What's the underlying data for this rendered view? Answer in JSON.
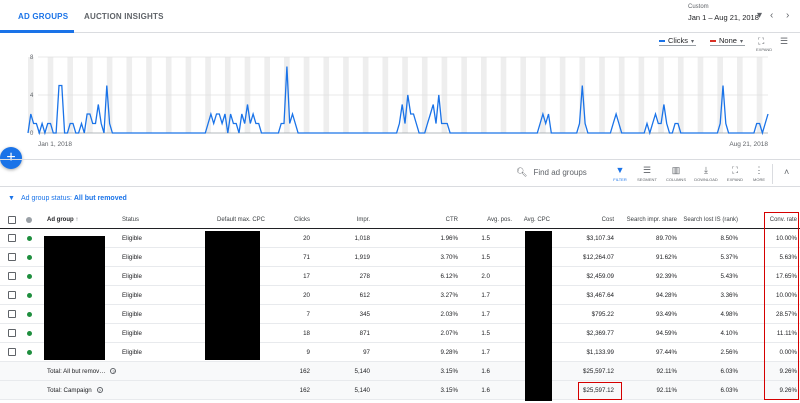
{
  "tabs": [
    {
      "label": "AD GROUPS"
    },
    {
      "label": "AUCTION INSIGHTS"
    }
  ],
  "date": {
    "label": "Custom",
    "range": "Jan 1 – Aug 21, 2018"
  },
  "chart": {
    "metric1": "Clicks",
    "metric2": "None",
    "expand_label": "EXPAND",
    "colors": {
      "metric1": "#1a73e8",
      "metric2": "#d93025"
    }
  },
  "chart_data": {
    "type": "line",
    "xlabel": "",
    "ylabel": "",
    "x_start": "Jan 1, 2018",
    "x_end": "Aug 21, 2018",
    "yticks": [
      "8",
      "4",
      "0"
    ],
    "ylim": [
      0,
      8
    ],
    "series": [
      {
        "name": "Clicks",
        "values": [
          0,
          2,
          1,
          1,
          0,
          1,
          0,
          1,
          1,
          0,
          0,
          5,
          5,
          0,
          0,
          1,
          1,
          0,
          0,
          1,
          0,
          2,
          2,
          1,
          1,
          3,
          1,
          0,
          5,
          1,
          0,
          0,
          0,
          0,
          0,
          0,
          0,
          0,
          0,
          0,
          0,
          0,
          0,
          0,
          0,
          0,
          0,
          0,
          0,
          0,
          0,
          0,
          0,
          0,
          0,
          0,
          0,
          0,
          0,
          0,
          0,
          0,
          0,
          0,
          1,
          2,
          1,
          2,
          2,
          1,
          2,
          0,
          2,
          1,
          1,
          0,
          2,
          1,
          3,
          1,
          2,
          1,
          1,
          0,
          0,
          0,
          0,
          0,
          0,
          0,
          1,
          1,
          7,
          1,
          2,
          1,
          0,
          0,
          0,
          0,
          0,
          0,
          0,
          0,
          0,
          0,
          0,
          0,
          0,
          0,
          0,
          0,
          0,
          0,
          0,
          0,
          0,
          0,
          0,
          0,
          0,
          0,
          0,
          0,
          0,
          0,
          0,
          0,
          0,
          0,
          0,
          0,
          1,
          3,
          1,
          4,
          2,
          2,
          1,
          0,
          0,
          0,
          1,
          2,
          3,
          1,
          4,
          1,
          1,
          1,
          0,
          0,
          0,
          0,
          0,
          0,
          0,
          0,
          0,
          0,
          0,
          0,
          0,
          0,
          0,
          0,
          0,
          0,
          0,
          0,
          0,
          0,
          0,
          0,
          0,
          0,
          0,
          0,
          0,
          0,
          0,
          0,
          1,
          2,
          1,
          2,
          0,
          0,
          0,
          0,
          0,
          0,
          0,
          0,
          0,
          0,
          1,
          5,
          1,
          0,
          0,
          0,
          0,
          0,
          0,
          0,
          0,
          0,
          1,
          2,
          1,
          0,
          0,
          0,
          0,
          0,
          0,
          0,
          0,
          0,
          1,
          0,
          1,
          2,
          1,
          1,
          3,
          1,
          0,
          0,
          1,
          1,
          0,
          0,
          0,
          0,
          0,
          0,
          0,
          0,
          0,
          0,
          0,
          0,
          0,
          0,
          1,
          5,
          1,
          0,
          0,
          0,
          0,
          0,
          0,
          0,
          0,
          0,
          0,
          1,
          1,
          0,
          1,
          2
        ]
      }
    ]
  },
  "fab": "+",
  "toolbar": {
    "search_placeholder": "Find ad groups",
    "tools": [
      {
        "label": "FILTER",
        "icon": "▼"
      },
      {
        "label": "SEGMENT",
        "icon": "☰"
      },
      {
        "label": "COLUMNS",
        "icon": "▥"
      },
      {
        "label": "DOWNLOAD",
        "icon": "⤓"
      },
      {
        "label": "EXPAND",
        "icon": "⛶"
      },
      {
        "label": "MORE",
        "icon": "⋮"
      }
    ]
  },
  "filter": {
    "prefix": "Ad group status: ",
    "value": "All but removed"
  },
  "table": {
    "headers": {
      "ad_group": "Ad group",
      "status": "Status",
      "default_cpc": "Default max. CPC",
      "clicks": "Clicks",
      "impr": "Impr.",
      "ctr": "CTR",
      "avg_pos": "Avg. pos.",
      "avg_cpc": "Avg. CPC",
      "cost": "Cost",
      "search_impr_share": "Search impr. share",
      "search_lost_is": "Search lost IS (rank)",
      "conv_rate": "Conv. rate"
    },
    "rows": [
      {
        "status": "Eligible",
        "clicks": "20",
        "impr": "1,018",
        "ctr": "1.96%",
        "avg_pos": "1.5",
        "cost": "$3,107.34",
        "sis": "89.70%",
        "lost": "8.50%",
        "conv": "10.00%"
      },
      {
        "status": "Eligible",
        "clicks": "71",
        "impr": "1,919",
        "ctr": "3.70%",
        "avg_pos": "1.5",
        "cost": "$12,264.07",
        "sis": "91.62%",
        "lost": "5.37%",
        "conv": "5.63%"
      },
      {
        "status": "Eligible",
        "clicks": "17",
        "impr": "278",
        "ctr": "6.12%",
        "avg_pos": "2.0",
        "cost": "$2,459.09",
        "sis": "92.39%",
        "lost": "5.43%",
        "conv": "17.65%"
      },
      {
        "status": "Eligible",
        "clicks": "20",
        "impr": "612",
        "ctr": "3.27%",
        "avg_pos": "1.7",
        "cost": "$3,467.64",
        "sis": "94.28%",
        "lost": "3.36%",
        "conv": "10.00%"
      },
      {
        "status": "Eligible",
        "clicks": "7",
        "impr": "345",
        "ctr": "2.03%",
        "avg_pos": "1.7",
        "cost": "$795.22",
        "sis": "93.49%",
        "lost": "4.98%",
        "conv": "28.57%"
      },
      {
        "status": "Eligible",
        "clicks": "18",
        "impr": "871",
        "ctr": "2.07%",
        "avg_pos": "1.5",
        "cost": "$2,369.77",
        "sis": "94.59%",
        "lost": "4.10%",
        "conv": "11.11%"
      },
      {
        "status": "Eligible",
        "clicks": "9",
        "impr": "97",
        "ctr": "9.28%",
        "avg_pos": "1.7",
        "cost": "$1,133.99",
        "sis": "97.44%",
        "lost": "2.56%",
        "conv": "0.00%"
      }
    ],
    "totals": [
      {
        "label": "Total: All but remov…",
        "clicks": "162",
        "impr": "5,140",
        "ctr": "3.15%",
        "avg_pos": "1.6",
        "cost": "$25,597.12",
        "sis": "92.11%",
        "lost": "6.03%",
        "conv": "9.26%"
      },
      {
        "label": "Total: Campaign",
        "clicks": "162",
        "impr": "5,140",
        "ctr": "3.15%",
        "avg_pos": "1.6",
        "cost": "$25,597.12",
        "sis": "92.11%",
        "lost": "6.03%",
        "conv": "9.26%"
      }
    ]
  }
}
